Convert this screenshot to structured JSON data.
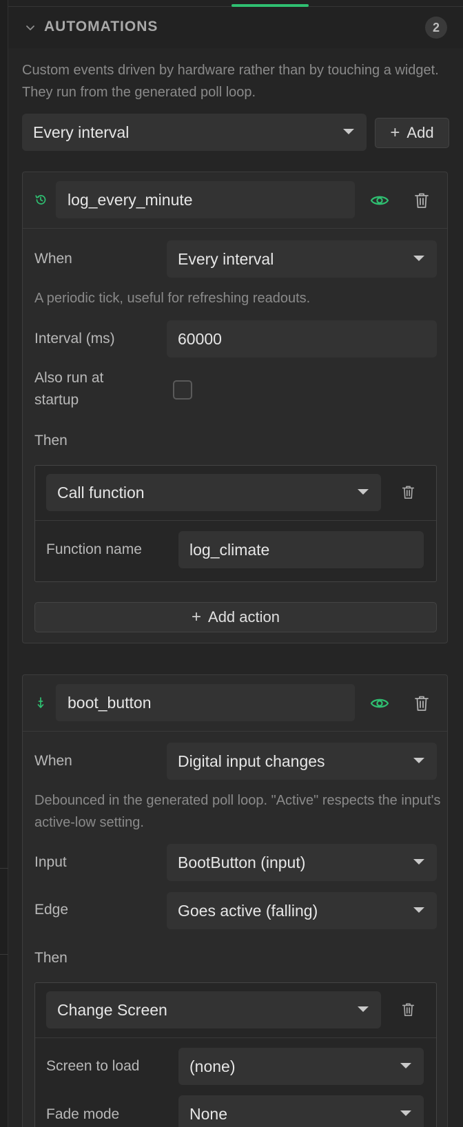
{
  "section": {
    "title": "AUTOMATIONS",
    "count": "2",
    "description": "Custom events driven by hardware rather than by touching a widget. They run from the generated poll loop.",
    "new_trigger": "Every interval",
    "add_label": "Add"
  },
  "automations": [
    {
      "name": "log_every_minute",
      "when_label": "When",
      "when_value": "Every interval",
      "hint": "A periodic tick, useful for refreshing readouts.",
      "interval_label": "Interval (ms)",
      "interval_value": "60000",
      "startup_label": "Also run at startup",
      "startup_checked": false,
      "then_label": "Then",
      "action": {
        "type": "Call function",
        "param_label": "Function name",
        "param_value": "log_climate"
      },
      "add_action_label": "Add action"
    },
    {
      "name": "boot_button",
      "when_label": "When",
      "when_value": "Digital input changes",
      "hint": "Debounced in the generated poll loop. \"Active\" respects the input's active-low setting.",
      "input_label": "Input",
      "input_value": "BootButton (input)",
      "edge_label": "Edge",
      "edge_value": "Goes active (falling)",
      "then_label": "Then",
      "action": {
        "type": "Change Screen",
        "screen_label": "Screen to load",
        "screen_value": "(none)",
        "fade_label": "Fade mode",
        "fade_value": "None"
      }
    }
  ],
  "icons": {
    "collapse": "chevron-down-icon",
    "interval": "history-icon",
    "input_change": "pin-arrow-icon",
    "visibility": "eye-icon",
    "delete": "trash-icon",
    "add": "plus-icon"
  },
  "colors": {
    "accent": "#2fbf71",
    "background": "#252525",
    "card": "#2b2b2b",
    "field": "#333333"
  }
}
